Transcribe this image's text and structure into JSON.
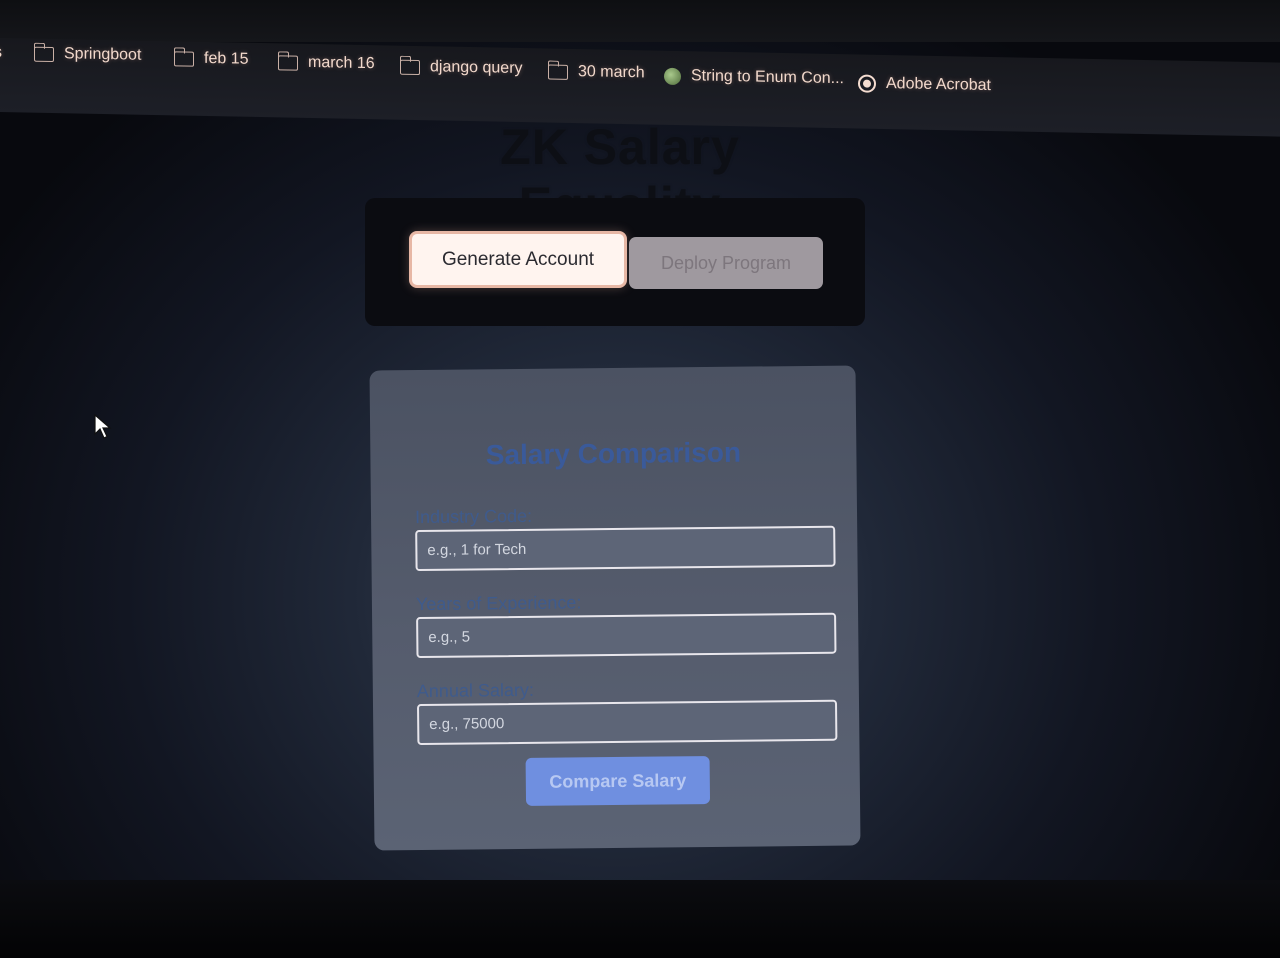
{
  "bookmarks": [
    {
      "label": "s",
      "icon": "folder-icon"
    },
    {
      "label": "Springboot",
      "icon": "folder-icon"
    },
    {
      "label": "feb 15",
      "icon": "folder-icon"
    },
    {
      "label": "march 16",
      "icon": "folder-icon"
    },
    {
      "label": "django query",
      "icon": "folder-icon"
    },
    {
      "label": "30 march",
      "icon": "folder-icon"
    },
    {
      "label": "String to Enum Con...",
      "icon": "site-favicon-icon"
    },
    {
      "label": "Adobe Acrobat",
      "icon": "globe-icon"
    }
  ],
  "page": {
    "title": "ZK Salary Equality"
  },
  "actions": {
    "generate_label": "Generate Account",
    "deploy_label": "Deploy Program"
  },
  "form": {
    "title": "Salary Comparison",
    "industry": {
      "label": "Industry Code:",
      "placeholder": "e.g., 1 for Tech"
    },
    "experience": {
      "label": "Years of Experience:",
      "placeholder": "e.g., 5"
    },
    "salary": {
      "label": "Annual Salary:",
      "placeholder": "e.g., 75000"
    },
    "submit_label": "Compare Salary"
  },
  "colors": {
    "accent_button": "#6f8fe0",
    "form_title": "#3a5a9a",
    "bookmark_text": "#f2d9cc"
  }
}
